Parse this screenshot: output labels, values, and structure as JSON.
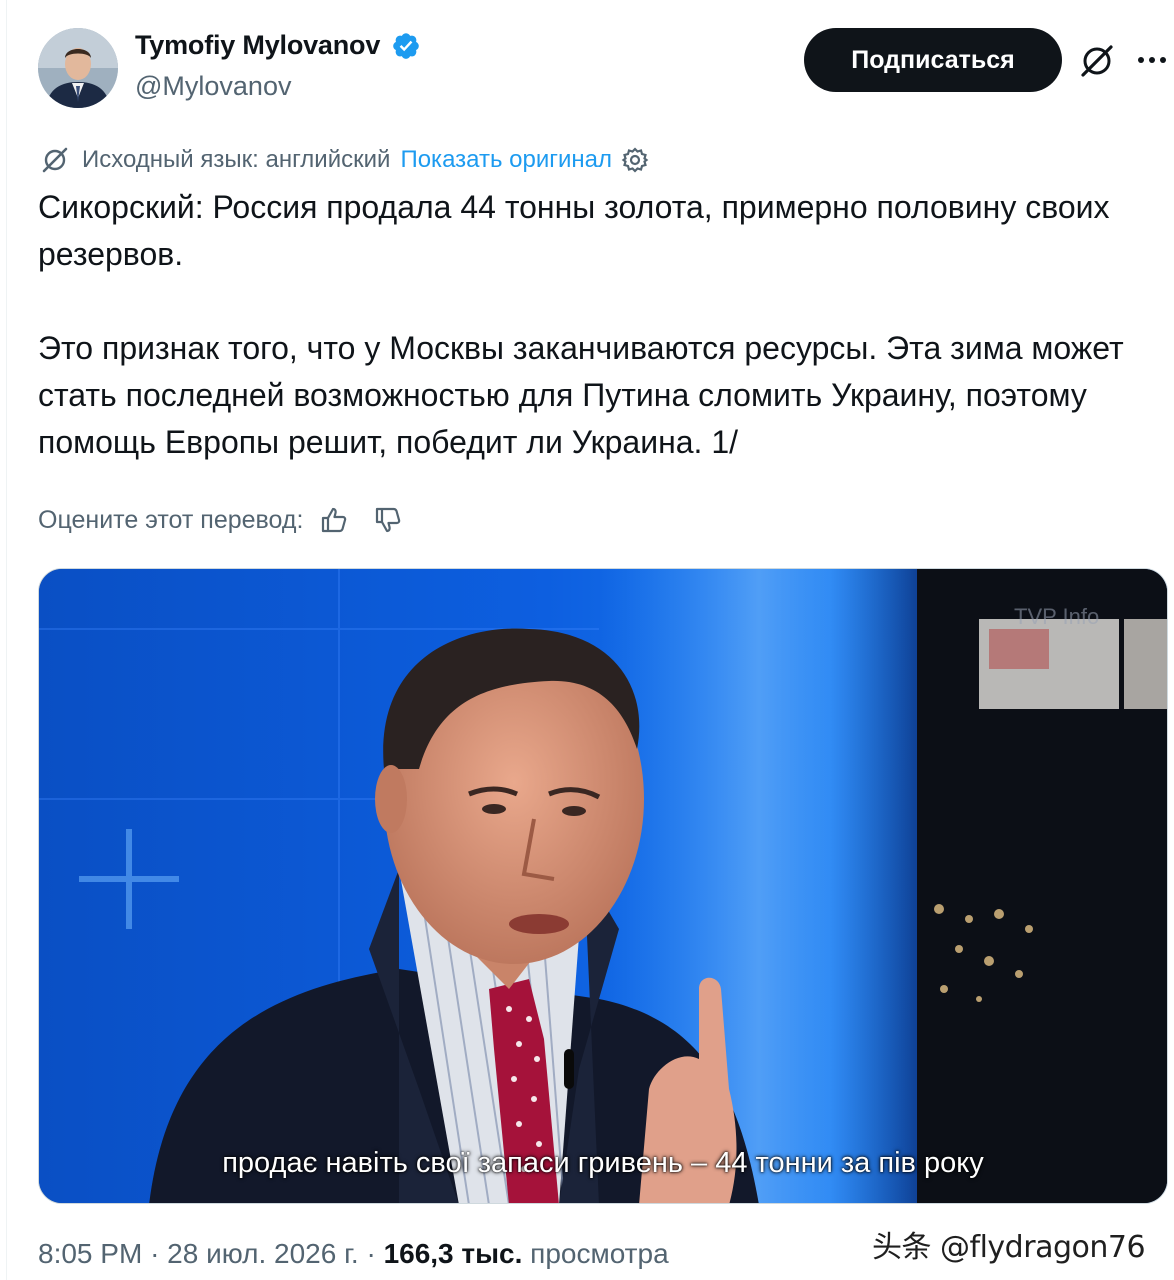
{
  "author": {
    "display_name": "Tymofiy Mylovanov",
    "handle": "@Mylovanov",
    "verified": true
  },
  "actions": {
    "subscribe_label": "Подписаться",
    "grok_icon": "grok-slash-icon",
    "more_icon": "more-horizontal-icon"
  },
  "translation": {
    "source_language_text": "Исходный язык: английский",
    "show_original_label": "Показать оригинал",
    "rate_prompt": "Оцените этот перевод:"
  },
  "tweet": {
    "paragraph_1": "Сикорский: Россия продала 44 тонны золота, примерно половину своих резервов.",
    "paragraph_2": "Это признак того, что у Москвы заканчиваются ресурсы. Эта зима может стать последней возможностью для Путина сломить Украину, поэтому помощь Европы решит, победит ли Украина. 1/"
  },
  "media": {
    "subtitle": "продає навіть свої запаси гривень – 44 тонни за пів року",
    "channel_logo_text": "TVP Info"
  },
  "footer": {
    "time": "8:05 PM",
    "separator": "·",
    "date": "28 июл. 2026 г.",
    "views_count": "166,3 тыс.",
    "views_label": "просмотра"
  },
  "watermark": "头条 @flydragon76",
  "colors": {
    "accent_blue": "#1d9bf0",
    "text_primary": "#0f1419",
    "text_secondary": "#536471",
    "button_dark": "#0f1419"
  }
}
